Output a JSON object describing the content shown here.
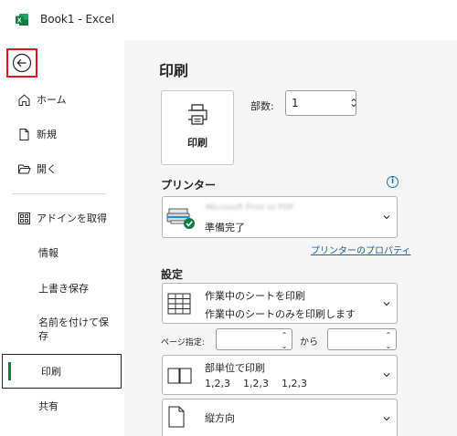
{
  "titlebar": {
    "app_name": "Book1 - Excel",
    "logo_color": "#107c41"
  },
  "sidebar": {
    "back_label": "back",
    "items": [
      {
        "label": "ホーム",
        "icon": "home-icon"
      },
      {
        "label": "新規",
        "icon": "new-document-icon"
      },
      {
        "label": "開く",
        "icon": "open-folder-icon"
      },
      {
        "label": "アドインを取得",
        "icon": "addins-grid-icon"
      },
      {
        "label": "情報"
      },
      {
        "label": "上書き保存"
      },
      {
        "label": "名前を付けて保存"
      },
      {
        "label": "印刷",
        "selected": true
      },
      {
        "label": "共有"
      }
    ]
  },
  "main": {
    "heading": "印刷",
    "print_button_label": "印刷",
    "copies_label": "部数:",
    "copies_value": "1",
    "printer_section_title": "プリンター",
    "printer_name_blurred": "Microsoft Print to PDF",
    "printer_status": "準備完了",
    "printer_properties_link": "プリンターのプロパティ",
    "settings_section_title": "設定",
    "print_what": {
      "title": "作業中のシートを印刷",
      "subtitle": "作業中のシートのみを印刷します"
    },
    "page_range_label": "ページ指定:",
    "page_range_from": "",
    "page_range_to_label": "から",
    "page_range_to": "",
    "collation": {
      "title": "部単位で印刷",
      "subtitle": "1,2,3    1,2,3    1,2,3"
    },
    "orientation": {
      "title": "縦方向"
    },
    "colors": {
      "accent_green": "#107c41",
      "link_blue": "#1a5ea8",
      "highlight_red": "#e81123"
    }
  }
}
